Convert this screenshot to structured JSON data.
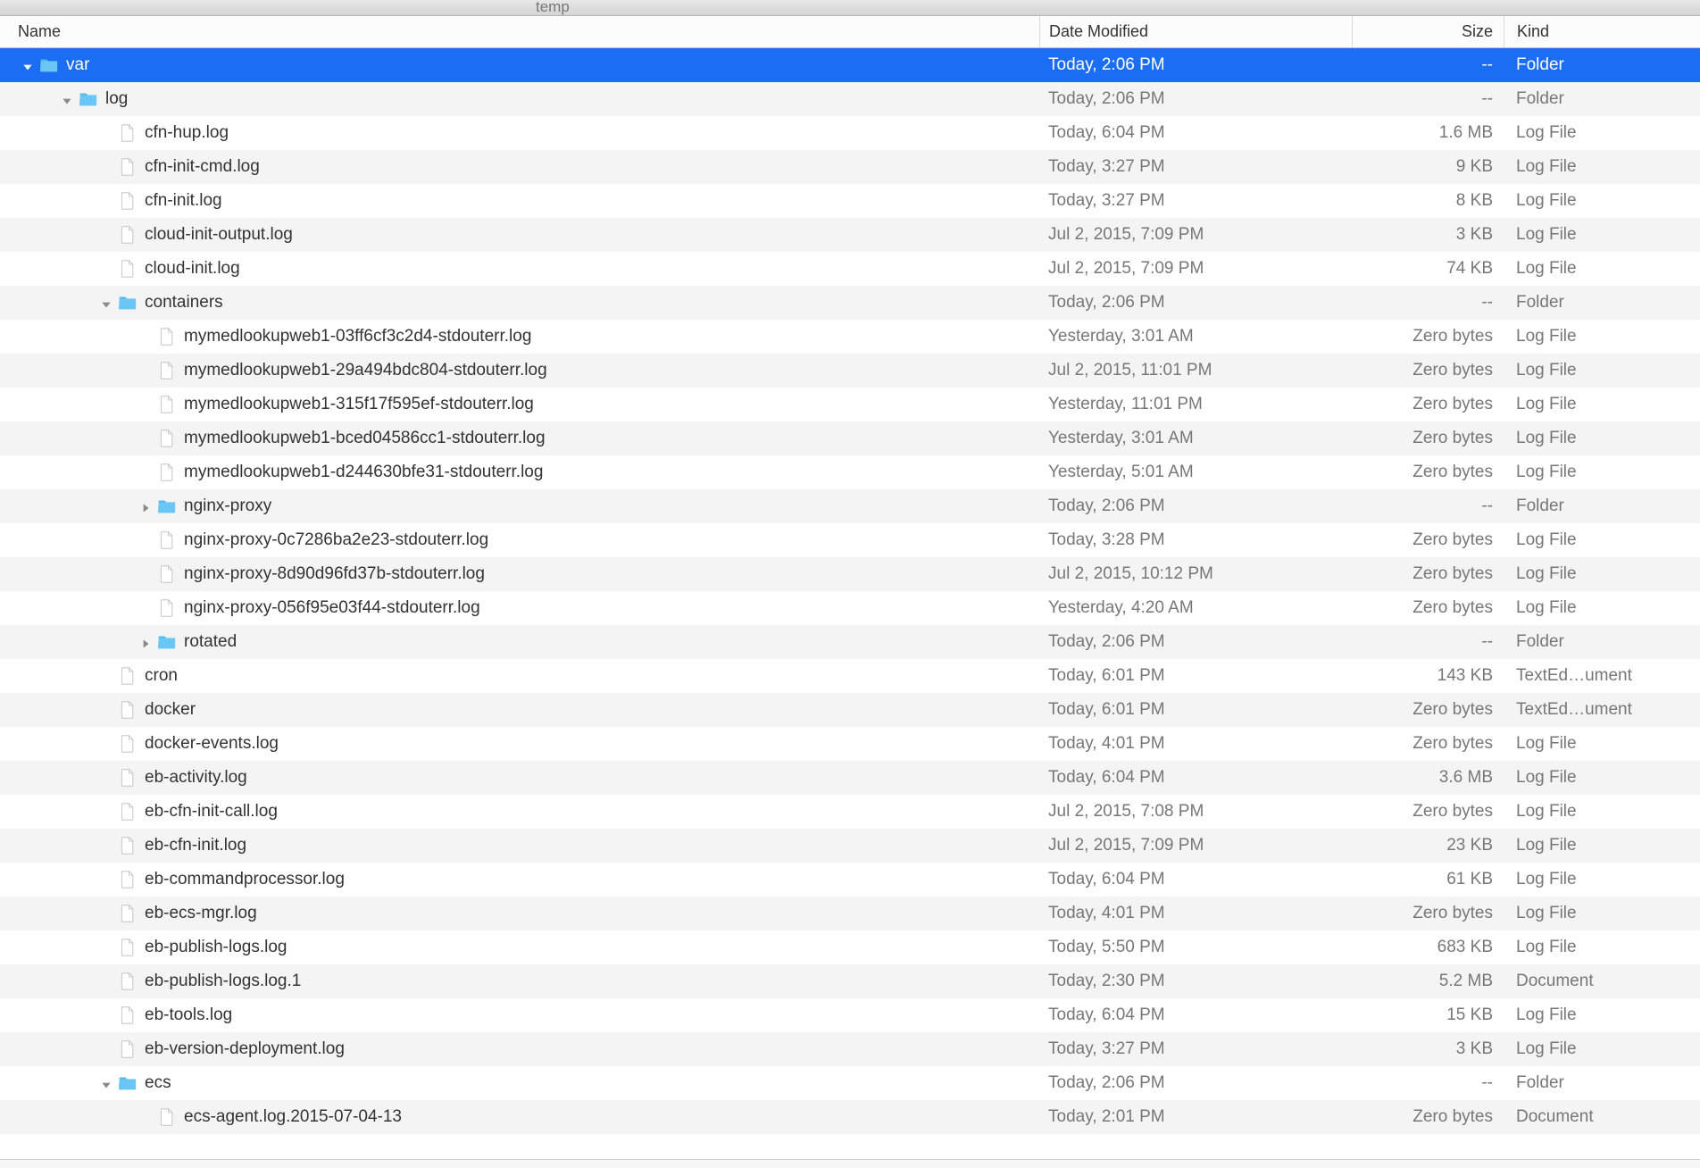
{
  "window": {
    "title": "temp"
  },
  "columns": {
    "name": "Name",
    "date": "Date Modified",
    "size": "Size",
    "kind": "Kind"
  },
  "rows": [
    {
      "depth": 0,
      "type": "folder",
      "expanded": true,
      "selected": true,
      "name": "var",
      "date": "Today, 2:06 PM",
      "size": "--",
      "kind": "Folder"
    },
    {
      "depth": 1,
      "type": "folder",
      "expanded": true,
      "name": "log",
      "date": "Today, 2:06 PM",
      "size": "--",
      "kind": "Folder"
    },
    {
      "depth": 2,
      "type": "file",
      "name": "cfn-hup.log",
      "date": "Today, 6:04 PM",
      "size": "1.6 MB",
      "kind": "Log File"
    },
    {
      "depth": 2,
      "type": "file",
      "name": "cfn-init-cmd.log",
      "date": "Today, 3:27 PM",
      "size": "9 KB",
      "kind": "Log File"
    },
    {
      "depth": 2,
      "type": "file",
      "name": "cfn-init.log",
      "date": "Today, 3:27 PM",
      "size": "8 KB",
      "kind": "Log File"
    },
    {
      "depth": 2,
      "type": "file",
      "name": "cloud-init-output.log",
      "date": "Jul 2, 2015, 7:09 PM",
      "size": "3 KB",
      "kind": "Log File"
    },
    {
      "depth": 2,
      "type": "file",
      "name": "cloud-init.log",
      "date": "Jul 2, 2015, 7:09 PM",
      "size": "74 KB",
      "kind": "Log File"
    },
    {
      "depth": 2,
      "type": "folder",
      "expanded": true,
      "name": "containers",
      "date": "Today, 2:06 PM",
      "size": "--",
      "kind": "Folder"
    },
    {
      "depth": 3,
      "type": "file",
      "name": "mymedlookupweb1-03ff6cf3c2d4-stdouterr.log",
      "date": "Yesterday, 3:01 AM",
      "size": "Zero bytes",
      "kind": "Log File"
    },
    {
      "depth": 3,
      "type": "file",
      "name": "mymedlookupweb1-29a494bdc804-stdouterr.log",
      "date": "Jul 2, 2015, 11:01 PM",
      "size": "Zero bytes",
      "kind": "Log File"
    },
    {
      "depth": 3,
      "type": "file",
      "name": "mymedlookupweb1-315f17f595ef-stdouterr.log",
      "date": "Yesterday, 11:01 PM",
      "size": "Zero bytes",
      "kind": "Log File"
    },
    {
      "depth": 3,
      "type": "file",
      "name": "mymedlookupweb1-bced04586cc1-stdouterr.log",
      "date": "Yesterday, 3:01 AM",
      "size": "Zero bytes",
      "kind": "Log File"
    },
    {
      "depth": 3,
      "type": "file",
      "name": "mymedlookupweb1-d244630bfe31-stdouterr.log",
      "date": "Yesterday, 5:01 AM",
      "size": "Zero bytes",
      "kind": "Log File"
    },
    {
      "depth": 3,
      "type": "folder",
      "expanded": false,
      "name": "nginx-proxy",
      "date": "Today, 2:06 PM",
      "size": "--",
      "kind": "Folder"
    },
    {
      "depth": 3,
      "type": "file",
      "name": "nginx-proxy-0c7286ba2e23-stdouterr.log",
      "date": "Today, 3:28 PM",
      "size": "Zero bytes",
      "kind": "Log File"
    },
    {
      "depth": 3,
      "type": "file",
      "name": "nginx-proxy-8d90d96fd37b-stdouterr.log",
      "date": "Jul 2, 2015, 10:12 PM",
      "size": "Zero bytes",
      "kind": "Log File"
    },
    {
      "depth": 3,
      "type": "file",
      "name": "nginx-proxy-056f95e03f44-stdouterr.log",
      "date": "Yesterday, 4:20 AM",
      "size": "Zero bytes",
      "kind": "Log File"
    },
    {
      "depth": 3,
      "type": "folder",
      "expanded": false,
      "name": "rotated",
      "date": "Today, 2:06 PM",
      "size": "--",
      "kind": "Folder"
    },
    {
      "depth": 2,
      "type": "file",
      "name": "cron",
      "date": "Today, 6:01 PM",
      "size": "143 KB",
      "kind": "TextEd…ument"
    },
    {
      "depth": 2,
      "type": "file",
      "name": "docker",
      "date": "Today, 6:01 PM",
      "size": "Zero bytes",
      "kind": "TextEd…ument"
    },
    {
      "depth": 2,
      "type": "file",
      "name": "docker-events.log",
      "date": "Today, 4:01 PM",
      "size": "Zero bytes",
      "kind": "Log File"
    },
    {
      "depth": 2,
      "type": "file",
      "name": "eb-activity.log",
      "date": "Today, 6:04 PM",
      "size": "3.6 MB",
      "kind": "Log File"
    },
    {
      "depth": 2,
      "type": "file",
      "name": "eb-cfn-init-call.log",
      "date": "Jul 2, 2015, 7:08 PM",
      "size": "Zero bytes",
      "kind": "Log File"
    },
    {
      "depth": 2,
      "type": "file",
      "name": "eb-cfn-init.log",
      "date": "Jul 2, 2015, 7:09 PM",
      "size": "23 KB",
      "kind": "Log File"
    },
    {
      "depth": 2,
      "type": "file",
      "name": "eb-commandprocessor.log",
      "date": "Today, 6:04 PM",
      "size": "61 KB",
      "kind": "Log File"
    },
    {
      "depth": 2,
      "type": "file",
      "name": "eb-ecs-mgr.log",
      "date": "Today, 4:01 PM",
      "size": "Zero bytes",
      "kind": "Log File"
    },
    {
      "depth": 2,
      "type": "file",
      "name": "eb-publish-logs.log",
      "date": "Today, 5:50 PM",
      "size": "683 KB",
      "kind": "Log File"
    },
    {
      "depth": 2,
      "type": "file",
      "name": "eb-publish-logs.log.1",
      "date": "Today, 2:30 PM",
      "size": "5.2 MB",
      "kind": "Document"
    },
    {
      "depth": 2,
      "type": "file",
      "name": "eb-tools.log",
      "date": "Today, 6:04 PM",
      "size": "15 KB",
      "kind": "Log File"
    },
    {
      "depth": 2,
      "type": "file",
      "name": "eb-version-deployment.log",
      "date": "Today, 3:27 PM",
      "size": "3 KB",
      "kind": "Log File"
    },
    {
      "depth": 2,
      "type": "folder",
      "expanded": true,
      "name": "ecs",
      "date": "Today, 2:06 PM",
      "size": "--",
      "kind": "Folder"
    },
    {
      "depth": 3,
      "type": "file",
      "name": "ecs-agent.log.2015-07-04-13",
      "date": "Today, 2:01 PM",
      "size": "Zero bytes",
      "kind": "Document"
    }
  ]
}
